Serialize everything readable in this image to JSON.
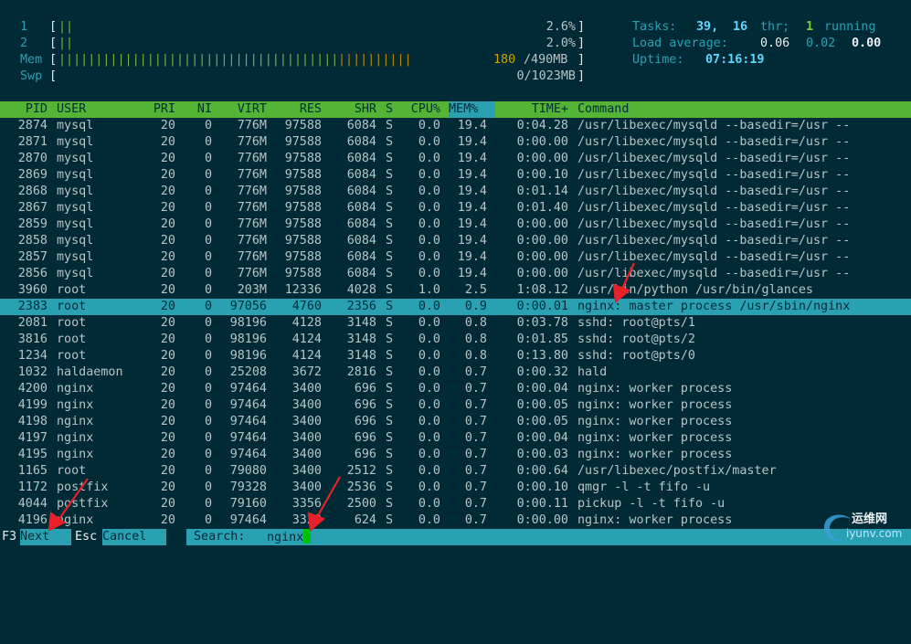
{
  "cpu_meters": [
    {
      "label": "1",
      "bar": "||",
      "value": "2.6%"
    },
    {
      "label": "2",
      "bar": "||",
      "value": "2.0%"
    }
  ],
  "mem": {
    "label": "Mem",
    "bar_green": "||||||||||||||||||||||||||||||||||||||",
    "bar_yellow": "||||||||||",
    "value_used": "180",
    "value_total": "/490MB"
  },
  "swp": {
    "label": "Swp",
    "value": "0/1023MB"
  },
  "stats": {
    "tasks_label": "Tasks:",
    "tasks": "39,",
    "threads": "16",
    "thr_label": "thr;",
    "running": "1",
    "running_label": "running",
    "load_label": "Load average:",
    "load1": "0.06",
    "load5": "0.02",
    "load15": "0.00",
    "uptime_label": "Uptime:",
    "uptime": "07:16:19"
  },
  "columns": {
    "pid": "PID",
    "user": "USER",
    "pri": "PRI",
    "ni": "NI",
    "virt": "VIRT",
    "res": "RES",
    "shr": "SHR",
    "s": "S",
    "cpu": "CPU%",
    "mem": "MEM%",
    "time": "TIME+",
    "command": "Command"
  },
  "processes": [
    {
      "pid": "2874",
      "user": "mysql",
      "pri": "20",
      "ni": "0",
      "virt": "776M",
      "res": "97588",
      "shr": "6084",
      "s": "S",
      "cpu": "0.0",
      "mem": "19.4",
      "time": "0:04.28",
      "command": "/usr/libexec/mysqld --basedir=/usr --"
    },
    {
      "pid": "2871",
      "user": "mysql",
      "pri": "20",
      "ni": "0",
      "virt": "776M",
      "res": "97588",
      "shr": "6084",
      "s": "S",
      "cpu": "0.0",
      "mem": "19.4",
      "time": "0:00.00",
      "command": "/usr/libexec/mysqld --basedir=/usr --"
    },
    {
      "pid": "2870",
      "user": "mysql",
      "pri": "20",
      "ni": "0",
      "virt": "776M",
      "res": "97588",
      "shr": "6084",
      "s": "S",
      "cpu": "0.0",
      "mem": "19.4",
      "time": "0:00.00",
      "command": "/usr/libexec/mysqld --basedir=/usr --"
    },
    {
      "pid": "2869",
      "user": "mysql",
      "pri": "20",
      "ni": "0",
      "virt": "776M",
      "res": "97588",
      "shr": "6084",
      "s": "S",
      "cpu": "0.0",
      "mem": "19.4",
      "time": "0:00.10",
      "command": "/usr/libexec/mysqld --basedir=/usr --"
    },
    {
      "pid": "2868",
      "user": "mysql",
      "pri": "20",
      "ni": "0",
      "virt": "776M",
      "res": "97588",
      "shr": "6084",
      "s": "S",
      "cpu": "0.0",
      "mem": "19.4",
      "time": "0:01.14",
      "command": "/usr/libexec/mysqld --basedir=/usr --"
    },
    {
      "pid": "2867",
      "user": "mysql",
      "pri": "20",
      "ni": "0",
      "virt": "776M",
      "res": "97588",
      "shr": "6084",
      "s": "S",
      "cpu": "0.0",
      "mem": "19.4",
      "time": "0:01.40",
      "command": "/usr/libexec/mysqld --basedir=/usr --"
    },
    {
      "pid": "2859",
      "user": "mysql",
      "pri": "20",
      "ni": "0",
      "virt": "776M",
      "res": "97588",
      "shr": "6084",
      "s": "S",
      "cpu": "0.0",
      "mem": "19.4",
      "time": "0:00.00",
      "command": "/usr/libexec/mysqld --basedir=/usr --"
    },
    {
      "pid": "2858",
      "user": "mysql",
      "pri": "20",
      "ni": "0",
      "virt": "776M",
      "res": "97588",
      "shr": "6084",
      "s": "S",
      "cpu": "0.0",
      "mem": "19.4",
      "time": "0:00.00",
      "command": "/usr/libexec/mysqld --basedir=/usr --"
    },
    {
      "pid": "2857",
      "user": "mysql",
      "pri": "20",
      "ni": "0",
      "virt": "776M",
      "res": "97588",
      "shr": "6084",
      "s": "S",
      "cpu": "0.0",
      "mem": "19.4",
      "time": "0:00.00",
      "command": "/usr/libexec/mysqld --basedir=/usr --"
    },
    {
      "pid": "2856",
      "user": "mysql",
      "pri": "20",
      "ni": "0",
      "virt": "776M",
      "res": "97588",
      "shr": "6084",
      "s": "S",
      "cpu": "0.0",
      "mem": "19.4",
      "time": "0:00.00",
      "command": "/usr/libexec/mysqld --basedir=/usr --"
    },
    {
      "pid": "3960",
      "user": "root",
      "pri": "20",
      "ni": "0",
      "virt": "203M",
      "res": "12336",
      "shr": "4028",
      "s": "S",
      "cpu": "1.0",
      "mem": "2.5",
      "time": "1:08.12",
      "command": "/usr/bin/python /usr/bin/glances"
    },
    {
      "pid": "2383",
      "user": "root",
      "pri": "20",
      "ni": "0",
      "virt": "97056",
      "res": "4760",
      "shr": "2356",
      "s": "S",
      "cpu": "0.0",
      "mem": "0.9",
      "time": "0:00.01",
      "command": "nginx: master process /usr/sbin/nginx",
      "selected": true
    },
    {
      "pid": "2081",
      "user": "root",
      "pri": "20",
      "ni": "0",
      "virt": "98196",
      "res": "4128",
      "shr": "3148",
      "s": "S",
      "cpu": "0.0",
      "mem": "0.8",
      "time": "0:03.78",
      "command": "sshd: root@pts/1"
    },
    {
      "pid": "3816",
      "user": "root",
      "pri": "20",
      "ni": "0",
      "virt": "98196",
      "res": "4124",
      "shr": "3148",
      "s": "S",
      "cpu": "0.0",
      "mem": "0.8",
      "time": "0:01.85",
      "command": "sshd: root@pts/2"
    },
    {
      "pid": "1234",
      "user": "root",
      "pri": "20",
      "ni": "0",
      "virt": "98196",
      "res": "4124",
      "shr": "3148",
      "s": "S",
      "cpu": "0.0",
      "mem": "0.8",
      "time": "0:13.80",
      "command": "sshd: root@pts/0"
    },
    {
      "pid": "1032",
      "user": "haldaemon",
      "pri": "20",
      "ni": "0",
      "virt": "25208",
      "res": "3672",
      "shr": "2816",
      "s": "S",
      "cpu": "0.0",
      "mem": "0.7",
      "time": "0:00.32",
      "command": "hald"
    },
    {
      "pid": "4200",
      "user": "nginx",
      "pri": "20",
      "ni": "0",
      "virt": "97464",
      "res": "3400",
      "shr": "696",
      "s": "S",
      "cpu": "0.0",
      "mem": "0.7",
      "time": "0:00.04",
      "command": "nginx: worker process"
    },
    {
      "pid": "4199",
      "user": "nginx",
      "pri": "20",
      "ni": "0",
      "virt": "97464",
      "res": "3400",
      "shr": "696",
      "s": "S",
      "cpu": "0.0",
      "mem": "0.7",
      "time": "0:00.05",
      "command": "nginx: worker process"
    },
    {
      "pid": "4198",
      "user": "nginx",
      "pri": "20",
      "ni": "0",
      "virt": "97464",
      "res": "3400",
      "shr": "696",
      "s": "S",
      "cpu": "0.0",
      "mem": "0.7",
      "time": "0:00.05",
      "command": "nginx: worker process"
    },
    {
      "pid": "4197",
      "user": "nginx",
      "pri": "20",
      "ni": "0",
      "virt": "97464",
      "res": "3400",
      "shr": "696",
      "s": "S",
      "cpu": "0.0",
      "mem": "0.7",
      "time": "0:00.04",
      "command": "nginx: worker process"
    },
    {
      "pid": "4195",
      "user": "nginx",
      "pri": "20",
      "ni": "0",
      "virt": "97464",
      "res": "3400",
      "shr": "696",
      "s": "S",
      "cpu": "0.0",
      "mem": "0.7",
      "time": "0:00.03",
      "command": "nginx: worker process"
    },
    {
      "pid": "1165",
      "user": "root",
      "pri": "20",
      "ni": "0",
      "virt": "79080",
      "res": "3400",
      "shr": "2512",
      "s": "S",
      "cpu": "0.0",
      "mem": "0.7",
      "time": "0:00.64",
      "command": "/usr/libexec/postfix/master"
    },
    {
      "pid": "1172",
      "user": "postfix",
      "pri": "20",
      "ni": "0",
      "virt": "79328",
      "res": "3400",
      "shr": "2536",
      "s": "S",
      "cpu": "0.0",
      "mem": "0.7",
      "time": "0:00.10",
      "command": "qmgr -l -t fifo -u"
    },
    {
      "pid": "4044",
      "user": "postfix",
      "pri": "20",
      "ni": "0",
      "virt": "79160",
      "res": "3356",
      "shr": "2500",
      "s": "S",
      "cpu": "0.0",
      "mem": "0.7",
      "time": "0:00.11",
      "command": "pickup -l -t fifo -u"
    },
    {
      "pid": "4196",
      "user": "nginx",
      "pri": "20",
      "ni": "0",
      "virt": "97464",
      "res": "3320",
      "shr": "624",
      "s": "S",
      "cpu": "0.0",
      "mem": "0.7",
      "time": "0:00.00",
      "command": "nginx: worker process"
    }
  ],
  "footer": {
    "f3_key": "F3",
    "f3_label": "Next",
    "esc_key": "Esc",
    "esc_label": "Cancel",
    "search_label": "Search:",
    "search_value": "nginx"
  },
  "watermark": {
    "text": "运维网",
    "url_text": "iyunv.com"
  },
  "colors": {
    "background": "#002b36",
    "header": "#54b435",
    "selection": "#2aa1b3",
    "arrow": "#e8202a"
  }
}
